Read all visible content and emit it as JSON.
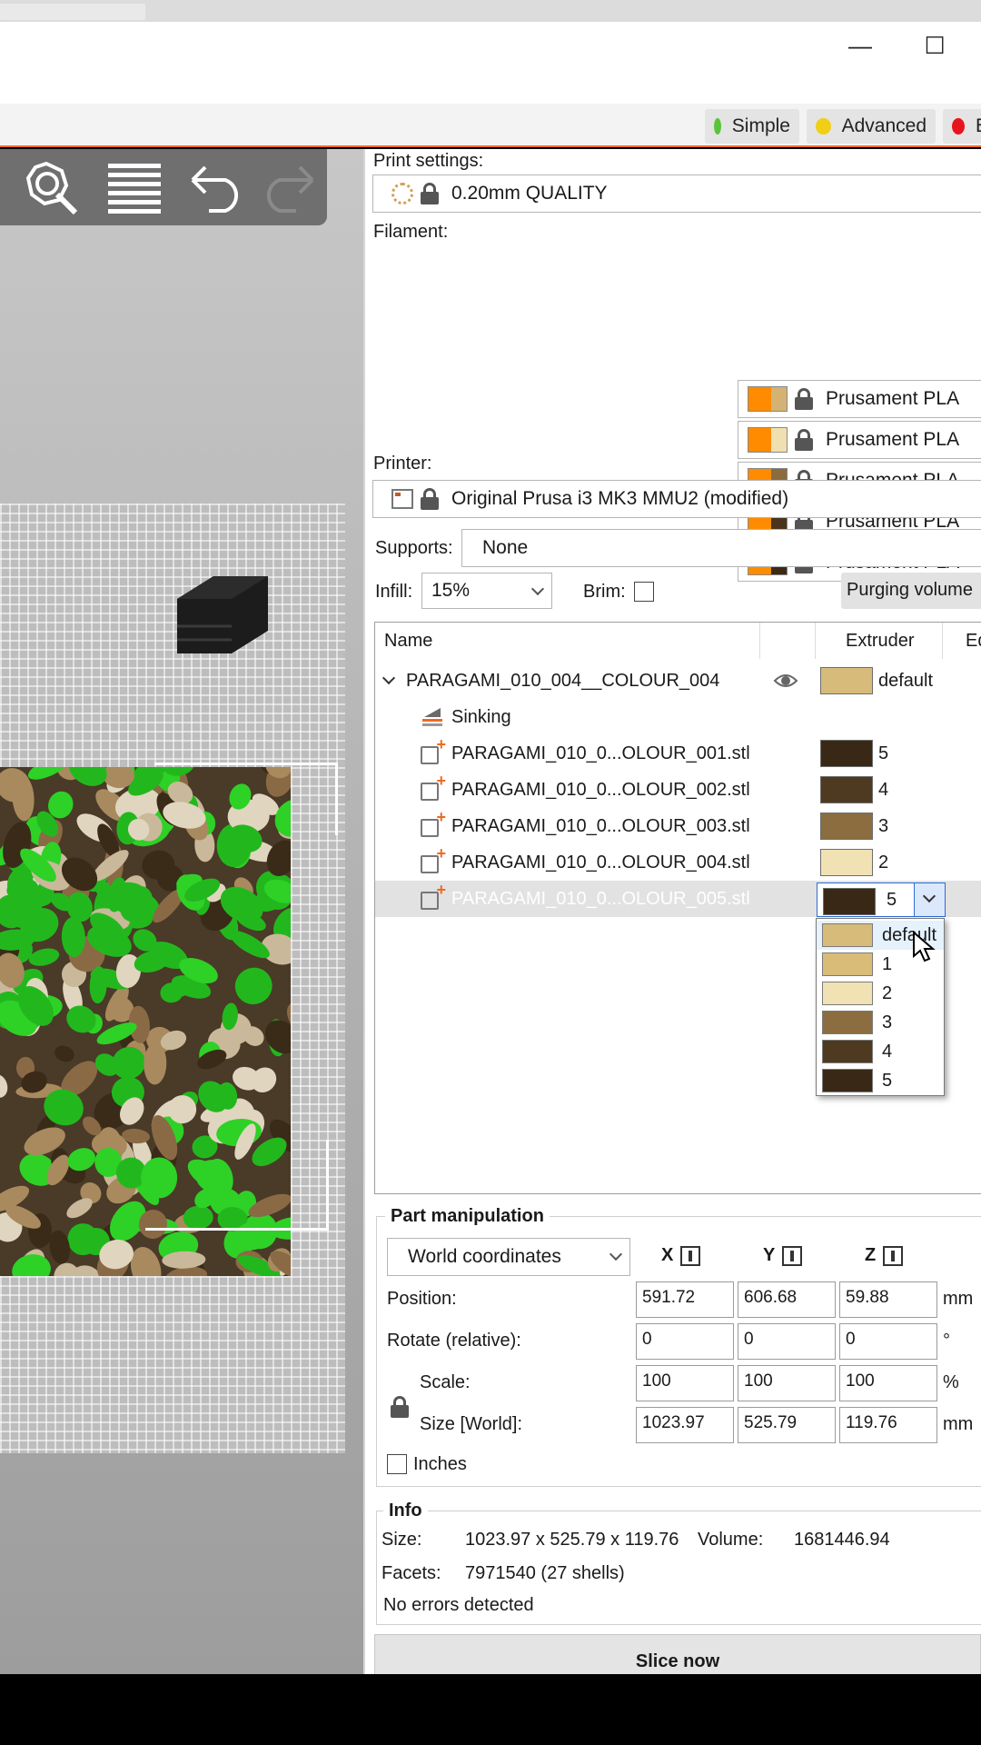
{
  "modes": [
    {
      "label": "Simple",
      "color": "#5bc43a"
    },
    {
      "label": "Advanced",
      "color": "#f1cf16"
    },
    {
      "label": "E",
      "color": "#e8141d"
    }
  ],
  "print_settings": {
    "label": "Print settings:",
    "value": "0.20mm QUALITY"
  },
  "filament": {
    "label": "Filament:",
    "items": [
      {
        "name": "Prusament PLA",
        "color": "#d4b273"
      },
      {
        "name": "Prusament PLA",
        "color": "#f0e0b0"
      },
      {
        "name": "Prusament PLA",
        "color": "#8a6c3e"
      },
      {
        "name": "Prusament PLA",
        "color": "#4a351c"
      },
      {
        "name": "Prusament PLA",
        "color": "#3d2a14"
      }
    ]
  },
  "printer": {
    "label": "Printer:",
    "value": "Original Prusa i3 MK3 MMU2 (modified)"
  },
  "supports": {
    "label": "Supports:",
    "value": "None"
  },
  "infill": {
    "label": "Infill:",
    "value": "15%"
  },
  "brim": {
    "label": "Brim:"
  },
  "purging_button": "Purging volume",
  "objlist": {
    "col_name": "Name",
    "col_extruder": "Extruder",
    "col_edit": "Ed",
    "object": {
      "name": "PARAGAMI_010_004__COLOUR_004",
      "extruder": "default",
      "color": "#d6bb7a"
    },
    "sinking": "Sinking",
    "parts": [
      {
        "name": "PARAGAMI_010_0...OLOUR_001.stl",
        "extruder": "5",
        "color": "#3a2816"
      },
      {
        "name": "PARAGAMI_010_0...OLOUR_002.stl",
        "extruder": "4",
        "color": "#4e3a20"
      },
      {
        "name": "PARAGAMI_010_0...OLOUR_003.stl",
        "extruder": "3",
        "color": "#8b6d3f"
      },
      {
        "name": "PARAGAMI_010_0...OLOUR_004.stl",
        "extruder": "2",
        "color": "#f1e2b4"
      },
      {
        "name": "PARAGAMI_010_0...OLOUR_005.stl",
        "extruder": "5",
        "color": "#3a2816"
      }
    ]
  },
  "dropdown": {
    "options": [
      {
        "label": "default",
        "color": "#d6bb7a"
      },
      {
        "label": "1",
        "color": "#d9bc78"
      },
      {
        "label": "2",
        "color": "#f1e2b4"
      },
      {
        "label": "3",
        "color": "#8b6d3f"
      },
      {
        "label": "4",
        "color": "#4e3a20"
      },
      {
        "label": "5",
        "color": "#3a2816"
      }
    ]
  },
  "manip": {
    "title": "Part manipulation",
    "coords": "World coordinates",
    "axes": [
      "X",
      "Y",
      "Z"
    ],
    "rows": [
      {
        "label": "Position:",
        "values": [
          "591.72",
          "606.68",
          "59.88"
        ],
        "unit": "mm"
      },
      {
        "label": "Rotate (relative):",
        "values": [
          "0",
          "0",
          "0"
        ],
        "unit": "°"
      },
      {
        "label": "Scale:",
        "values": [
          "100",
          "100",
          "100"
        ],
        "unit": "%"
      },
      {
        "label": "Size [World]:",
        "values": [
          "1023.97",
          "525.79",
          "119.76"
        ],
        "unit": "mm"
      }
    ],
    "inches": "Inches"
  },
  "info": {
    "title": "Info",
    "size_label": "Size:",
    "size_value": "1023.97 x 525.79 x 119.76",
    "volume_label": "Volume:",
    "volume_value": "1681446.94",
    "facets_label": "Facets:",
    "facets_value": "7971540 (27 shells)",
    "errors": "No errors detected"
  },
  "slice_button": "Slice now",
  "window": {
    "minimize": "—",
    "maximize": "☐"
  }
}
